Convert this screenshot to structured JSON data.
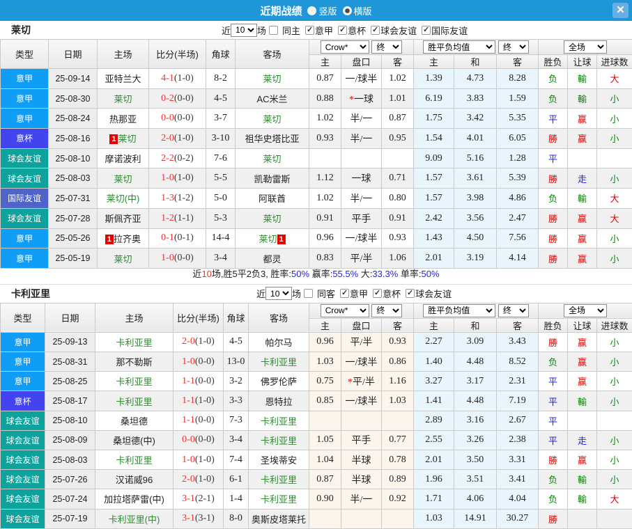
{
  "titlebar": {
    "title": "近期战绩",
    "radios": [
      {
        "label": "竖版",
        "checked": false
      },
      {
        "label": "横版",
        "checked": true
      }
    ],
    "close_label": "✕"
  },
  "colors": {
    "topbar": "#1e96d8",
    "league": "#109df5",
    "cup": "#4245ef",
    "club": "#0da29b",
    "intl": "#4f63c9",
    "team_green": "#2e8b2e",
    "score_red": "#e93333",
    "win_red": "#e60000",
    "lose_green": "#0a870a",
    "draw_blue": "#2222ee",
    "avg_bg": "#e9f5fc",
    "odds_bg_live": "#fcf5ec"
  },
  "header_labels": {
    "main": [
      "类型",
      "日期",
      "主场",
      "比分(半场)",
      "角球",
      "客场"
    ],
    "sub": [
      "主",
      "盘口",
      "客",
      "主",
      "和",
      "客",
      "胜负",
      "让球",
      "进球数"
    ]
  },
  "tables": [
    {
      "team": "莱切",
      "filter": {
        "prefix": "近",
        "count": "10",
        "suffix": "场",
        "checks": [
          {
            "label": "同主",
            "checked": false
          },
          {
            "label": "意甲",
            "checked": true
          },
          {
            "label": "意杯",
            "checked": true
          },
          {
            "label": "球会友谊",
            "checked": true
          },
          {
            "label": "国际友谊",
            "checked": true
          }
        ]
      },
      "dropdowns": {
        "odds_source": "Crow*",
        "odds_time": "终",
        "avg_source": "胜平负均值",
        "avg_time": "终",
        "scope": "全场"
      },
      "rows": [
        {
          "type": "意甲",
          "type_key": "league",
          "date": "25-09-14",
          "home": {
            "name": "亚特兰大"
          },
          "away": {
            "name": "莱切",
            "green": true
          },
          "ft": "4-1",
          "ht": "(1-0)",
          "corner": "8-2",
          "odds": [
            "0.87",
            "一/球半",
            "1.02"
          ],
          "pan_star": false,
          "avg": [
            "1.39",
            "4.73",
            "8.28"
          ],
          "wdl": {
            "t": "负",
            "c": "g"
          },
          "let": {
            "t": "輸",
            "c": "g"
          },
          "goals": {
            "t": "大",
            "c": "r"
          }
        },
        {
          "type": "意甲",
          "type_key": "league",
          "date": "25-08-30",
          "home": {
            "name": "莱切",
            "green": true
          },
          "away": {
            "name": "AC米兰"
          },
          "ft": "0-2",
          "ht": "(0-0)",
          "corner": "4-5",
          "odds": [
            "0.88",
            "一球",
            "1.01"
          ],
          "pan_star": true,
          "avg": [
            "6.19",
            "3.83",
            "1.59"
          ],
          "wdl": {
            "t": "负",
            "c": "g"
          },
          "let": {
            "t": "輸",
            "c": "g"
          },
          "goals": {
            "t": "小",
            "c": "g"
          }
        },
        {
          "type": "意甲",
          "type_key": "league",
          "date": "25-08-24",
          "home": {
            "name": "热那亚"
          },
          "away": {
            "name": "莱切",
            "green": true
          },
          "ft": "0-0",
          "ht": "(0-0)",
          "corner": "3-7",
          "odds": [
            "1.02",
            "半/一",
            "0.87"
          ],
          "pan_star": false,
          "avg": [
            "1.75",
            "3.42",
            "5.35"
          ],
          "wdl": {
            "t": "平",
            "c": "b"
          },
          "let": {
            "t": "赢",
            "c": "r"
          },
          "goals": {
            "t": "小",
            "c": "g"
          }
        },
        {
          "type": "意杯",
          "type_key": "cup",
          "date": "25-08-16",
          "home": {
            "name": "莱切",
            "green": true,
            "badge": "1",
            "badge_pos": "before"
          },
          "away": {
            "name": "祖华史塔比亚"
          },
          "ft": "2-0",
          "ht": "(1-0)",
          "corner": "3-10",
          "odds": [
            "0.93",
            "半/一",
            "0.95"
          ],
          "pan_star": false,
          "avg": [
            "1.54",
            "4.01",
            "6.05"
          ],
          "wdl": {
            "t": "勝",
            "c": "r"
          },
          "let": {
            "t": "赢",
            "c": "r"
          },
          "goals": {
            "t": "小",
            "c": "g"
          }
        },
        {
          "type": "球会友谊",
          "type_key": "club",
          "date": "25-08-10",
          "home": {
            "name": "摩诺波利"
          },
          "away": {
            "name": "莱切",
            "green": true
          },
          "ft": "2-2",
          "ht": "(0-2)",
          "corner": "7-6",
          "odds": [
            "",
            "",
            ""
          ],
          "pan_star": false,
          "avg": [
            "9.09",
            "5.16",
            "1.28"
          ],
          "wdl": {
            "t": "平",
            "c": "b"
          },
          "let": {
            "t": "",
            "c": ""
          },
          "goals": {
            "t": "",
            "c": ""
          }
        },
        {
          "type": "球会友谊",
          "type_key": "club",
          "date": "25-08-03",
          "home": {
            "name": "莱切",
            "green": true
          },
          "away": {
            "name": "凯勒雷斯"
          },
          "ft": "1-0",
          "ht": "(1-0)",
          "corner": "5-5",
          "odds": [
            "1.12",
            "一球",
            "0.71"
          ],
          "pan_star": false,
          "avg": [
            "1.57",
            "3.61",
            "5.39"
          ],
          "wdl": {
            "t": "勝",
            "c": "r"
          },
          "let": {
            "t": "走",
            "c": "b"
          },
          "goals": {
            "t": "小",
            "c": "g"
          }
        },
        {
          "type": "国际友谊",
          "type_key": "intl",
          "date": "25-07-31",
          "home": {
            "name": "莱切(中)",
            "green": true
          },
          "away": {
            "name": "阿联酋"
          },
          "ft": "1-3",
          "ht": "(1-2)",
          "corner": "5-0",
          "odds": [
            "1.02",
            "半/一",
            "0.80"
          ],
          "pan_star": false,
          "avg": [
            "1.57",
            "3.98",
            "4.86"
          ],
          "wdl": {
            "t": "负",
            "c": "g"
          },
          "let": {
            "t": "輸",
            "c": "g"
          },
          "goals": {
            "t": "大",
            "c": "r"
          }
        },
        {
          "type": "球会友谊",
          "type_key": "club",
          "date": "25-07-28",
          "home": {
            "name": "斯佩齐亚"
          },
          "away": {
            "name": "莱切",
            "green": true
          },
          "ft": "1-2",
          "ht": "(1-1)",
          "corner": "5-3",
          "odds": [
            "0.91",
            "平手",
            "0.91"
          ],
          "pan_star": false,
          "avg": [
            "2.42",
            "3.56",
            "2.47"
          ],
          "wdl": {
            "t": "勝",
            "c": "r"
          },
          "let": {
            "t": "赢",
            "c": "r"
          },
          "goals": {
            "t": "大",
            "c": "r"
          }
        },
        {
          "type": "意甲",
          "type_key": "league",
          "date": "25-05-26",
          "home": {
            "name": "拉齐奥",
            "badge": "1",
            "badge_pos": "before"
          },
          "away": {
            "name": "莱切",
            "green": true,
            "badge": "1",
            "badge_pos": "after"
          },
          "ft": "0-1",
          "ht": "(0-1)",
          "corner": "14-4",
          "odds": [
            "0.96",
            "一/球半",
            "0.93"
          ],
          "pan_star": false,
          "avg": [
            "1.43",
            "4.50",
            "7.56"
          ],
          "wdl": {
            "t": "勝",
            "c": "r"
          },
          "let": {
            "t": "赢",
            "c": "r"
          },
          "goals": {
            "t": "小",
            "c": "g"
          }
        },
        {
          "type": "意甲",
          "type_key": "league",
          "date": "25-05-19",
          "home": {
            "name": "莱切",
            "green": true
          },
          "away": {
            "name": "都灵"
          },
          "ft": "1-0",
          "ht": "(0-0)",
          "corner": "3-4",
          "odds": [
            "0.83",
            "平/半",
            "1.06"
          ],
          "pan_star": false,
          "avg": [
            "2.01",
            "3.19",
            "4.14"
          ],
          "wdl": {
            "t": "勝",
            "c": "r"
          },
          "let": {
            "t": "赢",
            "c": "r"
          },
          "goals": {
            "t": "小",
            "c": "g"
          }
        }
      ],
      "summary": [
        {
          "t": "近",
          "c": "k"
        },
        {
          "t": "10",
          "c": "r"
        },
        {
          "t": "场,胜5平2负3, 胜率:",
          "c": "k"
        },
        {
          "t": "50%",
          "c": "b"
        },
        {
          "t": " 赢率:",
          "c": "k"
        },
        {
          "t": "55.5%",
          "c": "b"
        },
        {
          "t": " 大:",
          "c": "k"
        },
        {
          "t": "33.3%",
          "c": "b"
        },
        {
          "t": " 单率:",
          "c": "k"
        },
        {
          "t": "50%",
          "c": "b"
        }
      ]
    },
    {
      "team": "卡利亚里",
      "filter": {
        "prefix": "近",
        "count": "10",
        "suffix": "场",
        "checks": [
          {
            "label": "同客",
            "checked": false
          },
          {
            "label": "意甲",
            "checked": true
          },
          {
            "label": "意杯",
            "checked": true
          },
          {
            "label": "球会友谊",
            "checked": true
          }
        ]
      },
      "dropdowns": {
        "odds_source": "Crow*",
        "odds_time": "终",
        "avg_source": "胜平负均值",
        "avg_time": "终",
        "scope": "全场"
      },
      "rows": [
        {
          "type": "意甲",
          "type_key": "league",
          "date": "25-09-13",
          "home": {
            "name": "卡利亚里",
            "green": true
          },
          "away": {
            "name": "帕尔马"
          },
          "ft": "2-0",
          "ht": "(1-0)",
          "corner": "4-5",
          "odds": [
            "0.96",
            "平/半",
            "0.93"
          ],
          "pan_star": false,
          "avg": [
            "2.27",
            "3.09",
            "3.43"
          ],
          "wdl": {
            "t": "勝",
            "c": "r"
          },
          "let": {
            "t": "赢",
            "c": "r"
          },
          "goals": {
            "t": "小",
            "c": "g"
          }
        },
        {
          "type": "意甲",
          "type_key": "league",
          "date": "25-08-31",
          "home": {
            "name": "那不勒斯"
          },
          "away": {
            "name": "卡利亚里",
            "green": true
          },
          "ft": "1-0",
          "ht": "(0-0)",
          "corner": "13-0",
          "odds": [
            "1.03",
            "一/球半",
            "0.86"
          ],
          "pan_star": false,
          "avg": [
            "1.40",
            "4.48",
            "8.52"
          ],
          "wdl": {
            "t": "负",
            "c": "g"
          },
          "let": {
            "t": "赢",
            "c": "r"
          },
          "goals": {
            "t": "小",
            "c": "g"
          }
        },
        {
          "type": "意甲",
          "type_key": "league",
          "date": "25-08-25",
          "home": {
            "name": "卡利亚里",
            "green": true
          },
          "away": {
            "name": "佛罗伦萨"
          },
          "ft": "1-1",
          "ht": "(0-0)",
          "corner": "3-2",
          "odds": [
            "0.75",
            "平/半",
            "1.16"
          ],
          "pan_star": true,
          "avg": [
            "3.27",
            "3.17",
            "2.31"
          ],
          "wdl": {
            "t": "平",
            "c": "b"
          },
          "let": {
            "t": "赢",
            "c": "r"
          },
          "goals": {
            "t": "小",
            "c": "g"
          }
        },
        {
          "type": "意杯",
          "type_key": "cup",
          "date": "25-08-17",
          "home": {
            "name": "卡利亚里",
            "green": true
          },
          "away": {
            "name": "恩特拉"
          },
          "ft": "1-1",
          "ht": "(1-0)",
          "corner": "3-3",
          "odds": [
            "0.85",
            "一/球半",
            "1.03"
          ],
          "pan_star": false,
          "avg": [
            "1.41",
            "4.48",
            "7.19"
          ],
          "wdl": {
            "t": "平",
            "c": "b"
          },
          "let": {
            "t": "輸",
            "c": "g"
          },
          "goals": {
            "t": "小",
            "c": "g"
          }
        },
        {
          "type": "球会友谊",
          "type_key": "club",
          "date": "25-08-10",
          "home": {
            "name": "桑坦德"
          },
          "away": {
            "name": "卡利亚里",
            "green": true
          },
          "ft": "1-1",
          "ht": "(0-0)",
          "corner": "7-3",
          "odds": [
            "",
            "",
            ""
          ],
          "pan_star": false,
          "avg": [
            "2.89",
            "3.16",
            "2.67"
          ],
          "wdl": {
            "t": "平",
            "c": "b"
          },
          "let": {
            "t": "",
            "c": ""
          },
          "goals": {
            "t": "",
            "c": ""
          }
        },
        {
          "type": "球会友谊",
          "type_key": "club",
          "date": "25-08-09",
          "home": {
            "name": "桑坦德(中)"
          },
          "away": {
            "name": "卡利亚里",
            "green": true
          },
          "ft": "0-0",
          "ht": "(0-0)",
          "corner": "3-4",
          "odds": [
            "1.05",
            "平手",
            "0.77"
          ],
          "pan_star": false,
          "avg": [
            "2.55",
            "3.26",
            "2.38"
          ],
          "wdl": {
            "t": "平",
            "c": "b"
          },
          "let": {
            "t": "走",
            "c": "b"
          },
          "goals": {
            "t": "小",
            "c": "g"
          }
        },
        {
          "type": "球会友谊",
          "type_key": "club",
          "date": "25-08-03",
          "home": {
            "name": "卡利亚里",
            "green": true
          },
          "away": {
            "name": "圣埃蒂安"
          },
          "ft": "1-0",
          "ht": "(1-0)",
          "corner": "7-4",
          "odds": [
            "1.04",
            "半球",
            "0.78"
          ],
          "pan_star": false,
          "avg": [
            "2.01",
            "3.50",
            "3.31"
          ],
          "wdl": {
            "t": "勝",
            "c": "r"
          },
          "let": {
            "t": "赢",
            "c": "r"
          },
          "goals": {
            "t": "小",
            "c": "g"
          }
        },
        {
          "type": "球会友谊",
          "type_key": "club",
          "date": "25-07-26",
          "home": {
            "name": "汉诺威96"
          },
          "away": {
            "name": "卡利亚里",
            "green": true
          },
          "ft": "2-0",
          "ht": "(1-0)",
          "corner": "6-1",
          "odds": [
            "0.87",
            "半球",
            "0.89"
          ],
          "pan_star": false,
          "avg": [
            "1.96",
            "3.51",
            "3.41"
          ],
          "wdl": {
            "t": "负",
            "c": "g"
          },
          "let": {
            "t": "輸",
            "c": "g"
          },
          "goals": {
            "t": "小",
            "c": "g"
          }
        },
        {
          "type": "球会友谊",
          "type_key": "club",
          "date": "25-07-24",
          "home": {
            "name": "加拉塔萨雷(中)"
          },
          "away": {
            "name": "卡利亚里",
            "green": true
          },
          "ft": "3-1",
          "ht": "(2-1)",
          "corner": "1-4",
          "odds": [
            "0.90",
            "半/一",
            "0.92"
          ],
          "pan_star": false,
          "avg": [
            "1.71",
            "4.06",
            "4.04"
          ],
          "wdl": {
            "t": "负",
            "c": "g"
          },
          "let": {
            "t": "輸",
            "c": "g"
          },
          "goals": {
            "t": "大",
            "c": "r"
          }
        },
        {
          "type": "球会友谊",
          "type_key": "club",
          "date": "25-07-19",
          "home": {
            "name": "卡利亚里(中)",
            "green": true
          },
          "away": {
            "name": "奥斯皮塔莱托"
          },
          "ft": "3-1",
          "ht": "(3-1)",
          "corner": "8-0",
          "odds": [
            "",
            "",
            ""
          ],
          "pan_star": false,
          "avg": [
            "1.03",
            "14.91",
            "30.27"
          ],
          "wdl": {
            "t": "勝",
            "c": "r"
          },
          "let": {
            "t": "",
            "c": ""
          },
          "goals": {
            "t": "",
            "c": ""
          }
        }
      ],
      "summary": null
    }
  ]
}
